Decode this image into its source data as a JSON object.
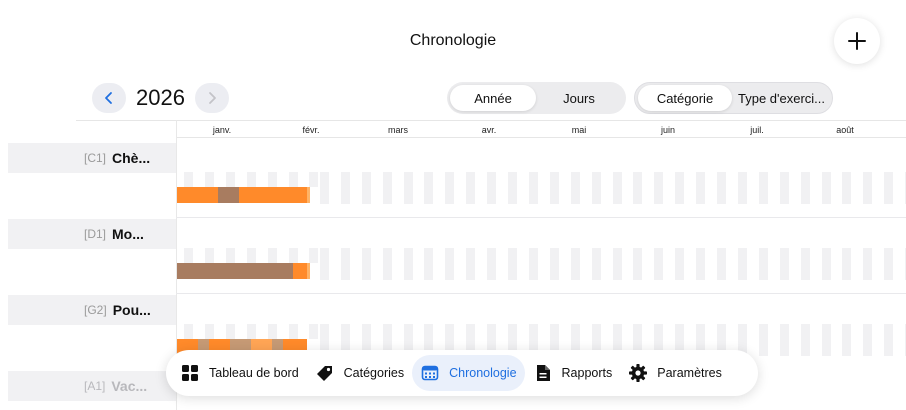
{
  "header": {
    "title": "Chronologie",
    "add_icon": "plus-icon"
  },
  "year_nav": {
    "year": "2026",
    "prev_icon": "chevron-left-icon",
    "next_icon": "chevron-right-icon"
  },
  "scale_toggle": {
    "options": [
      "Année",
      "Jours"
    ],
    "selected": "Année"
  },
  "group_toggle": {
    "options": [
      "Catégorie",
      "Type d'exerci..."
    ],
    "selected": "Catégorie"
  },
  "months": [
    "janv.",
    "févr.",
    "mars",
    "avr.",
    "mai",
    "juin",
    "juil.",
    "août"
  ],
  "lanes": [
    {
      "code": "[C1]",
      "name": "Chè...",
      "faded": false,
      "segments": [
        {
          "start": "janv. 1",
          "end": "janv. 16",
          "color": "orange"
        },
        {
          "start": "janv. 16",
          "end": "janv. 23",
          "color": "brown"
        },
        {
          "start": "janv. 23",
          "end": "févr. 15",
          "color": "orange"
        }
      ]
    },
    {
      "code": "[D1]",
      "name": "Mo...",
      "faded": false,
      "segments": [
        {
          "start": "janv. 1",
          "end": "févr. 11",
          "color": "brown"
        },
        {
          "start": "févr. 11",
          "end": "févr. 15",
          "color": "orange"
        }
      ]
    },
    {
      "code": "[G2]",
      "name": "Pou...",
      "faded": false,
      "segments": [
        {
          "start": "janv. 1",
          "end": "févr. 15",
          "color": "mixed"
        }
      ]
    },
    {
      "code": "[A1]",
      "name": "Vac...",
      "faded": true,
      "segments": []
    }
  ],
  "colors": {
    "orange": "#ff8a2a",
    "brown": "#a87c60",
    "accent": "#1f6fe0"
  },
  "tabbar": {
    "tabs": [
      {
        "label": "Tableau de bord",
        "icon": "dashboard-grid-icon"
      },
      {
        "label": "Catégories",
        "icon": "tag-icon"
      },
      {
        "label": "Chronologie",
        "icon": "calendar-icon",
        "selected": true
      },
      {
        "label": "Rapports",
        "icon": "document-icon"
      },
      {
        "label": "Paramètres",
        "icon": "gear-icon"
      }
    ]
  }
}
